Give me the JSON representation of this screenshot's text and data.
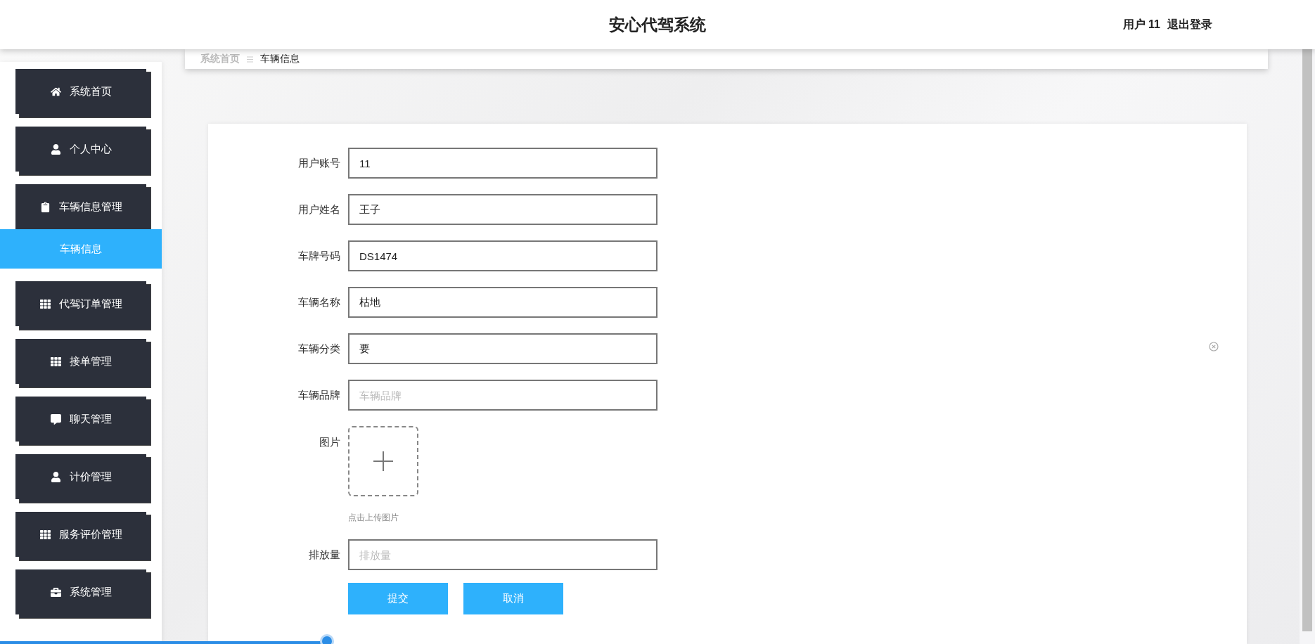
{
  "header": {
    "title": "安心代驾系统",
    "user": "用户 11",
    "logout": "退出登录"
  },
  "sidebar": {
    "items": [
      {
        "label": "系统首页"
      },
      {
        "label": "个人中心"
      },
      {
        "label": "车辆信息管理",
        "children": [
          {
            "label": "车辆信息",
            "selected": true
          }
        ]
      },
      {
        "label": "代驾订单管理"
      },
      {
        "label": "接单管理"
      },
      {
        "label": "聊天管理"
      },
      {
        "label": "计价管理"
      },
      {
        "label": "服务评价管理"
      },
      {
        "label": "系统管理"
      }
    ]
  },
  "breadcrumb": [
    {
      "label": "系统首页",
      "current": false
    },
    {
      "label": "车辆信息",
      "current": true
    }
  ],
  "form": {
    "fields": [
      {
        "kind": "text",
        "label": "用户账号",
        "value": "11"
      },
      {
        "kind": "text",
        "label": "用户姓名",
        "value": "王子"
      },
      {
        "kind": "text",
        "label": "车牌号码",
        "value": "DS1474"
      },
      {
        "kind": "text",
        "label": "车辆名称",
        "value": "枯地"
      },
      {
        "kind": "text",
        "label": "车辆分类",
        "value": "要"
      },
      {
        "kind": "text",
        "label": "车辆品牌",
        "placeholder": "车辆品牌"
      },
      {
        "kind": "upload",
        "label": "图片",
        "hint": "点击上传图片"
      },
      {
        "kind": "text",
        "label": "排放量",
        "placeholder": "排放量"
      }
    ],
    "buttons": [
      "提交",
      "取消"
    ]
  }
}
